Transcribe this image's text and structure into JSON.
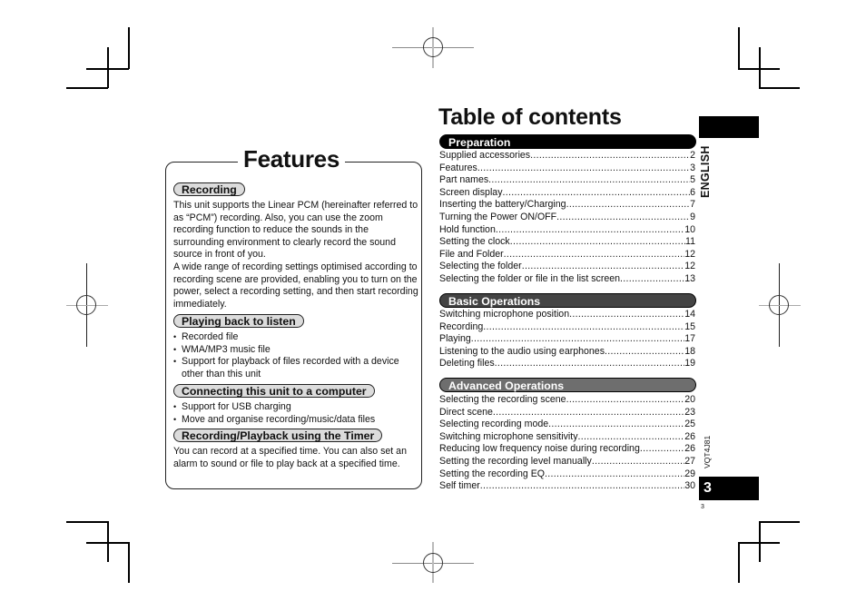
{
  "features": {
    "title": "Features",
    "sections": [
      {
        "heading": "Recording",
        "paragraphs": [
          "This unit supports the Linear PCM (hereinafter referred to as “PCM”) recording. Also, you can use the zoom recording function to reduce the sounds in the surrounding environment to clearly record the sound source in front of you.",
          "A wide range of recording settings optimised according to recording scene are provided, enabling you to turn on the power, select a recording setting, and then start recording immediately."
        ]
      },
      {
        "heading": "Playing back to listen",
        "bullets": [
          "Recorded file",
          "WMA/MP3 music file",
          "Support for playback of files recorded with a device other than this unit"
        ]
      },
      {
        "heading": "Connecting this unit to a computer",
        "bullets": [
          "Support for USB charging",
          "Move and organise recording/music/data files"
        ]
      },
      {
        "heading": "Recording/Playback using the Timer",
        "paragraphs": [
          "You can record at a specified time. You can also set an alarm to sound or file to play back at a specified time."
        ]
      }
    ]
  },
  "toc": {
    "title": "Table of contents",
    "sections": [
      {
        "heading": "Preparation",
        "color": "#000000",
        "entries": [
          {
            "title": "Supplied accessories",
            "page": "2"
          },
          {
            "title": "Features",
            "page": "3"
          },
          {
            "title": "Part names",
            "page": "5"
          },
          {
            "title": "Screen display",
            "page": "6"
          },
          {
            "title": "Inserting the battery/Charging",
            "page": "7"
          },
          {
            "title": "Turning the Power ON/OFF",
            "page": "9"
          },
          {
            "title": "Hold function",
            "page": "10"
          },
          {
            "title": "Setting the clock",
            "page": "11"
          },
          {
            "title": "File and Folder",
            "page": "12"
          },
          {
            "title": "Selecting the folder",
            "page": "12"
          },
          {
            "title": "Selecting the folder or file in the list screen",
            "page": "13"
          }
        ]
      },
      {
        "heading": "Basic Operations",
        "color": "#444444",
        "entries": [
          {
            "title": "Switching microphone position",
            "page": "14"
          },
          {
            "title": "Recording",
            "page": "15"
          },
          {
            "title": "Playing",
            "page": "17"
          },
          {
            "title": "Listening to the audio using earphones",
            "page": "18"
          },
          {
            "title": "Deleting files",
            "page": "19"
          }
        ]
      },
      {
        "heading": "Advanced Operations",
        "color": "#6e6e6e",
        "entries": [
          {
            "title": "Selecting the recording scene",
            "page": "20"
          },
          {
            "title": "Direct scene",
            "page": "23"
          },
          {
            "title": "Selecting recording mode",
            "page": "25"
          },
          {
            "title": "Switching microphone sensitivity",
            "page": "26"
          },
          {
            "title": "Reducing low frequency noise during recording",
            "page": "26"
          },
          {
            "title": "Setting the recording level manually",
            "page": "27"
          },
          {
            "title": "Setting the recording EQ",
            "page": "29"
          },
          {
            "title": "Self timer",
            "page": "30"
          }
        ]
      }
    ]
  },
  "side": {
    "language": "ENGLISH",
    "doc_code": "VQT4J81",
    "page_tab": "3",
    "page_number": "3"
  }
}
